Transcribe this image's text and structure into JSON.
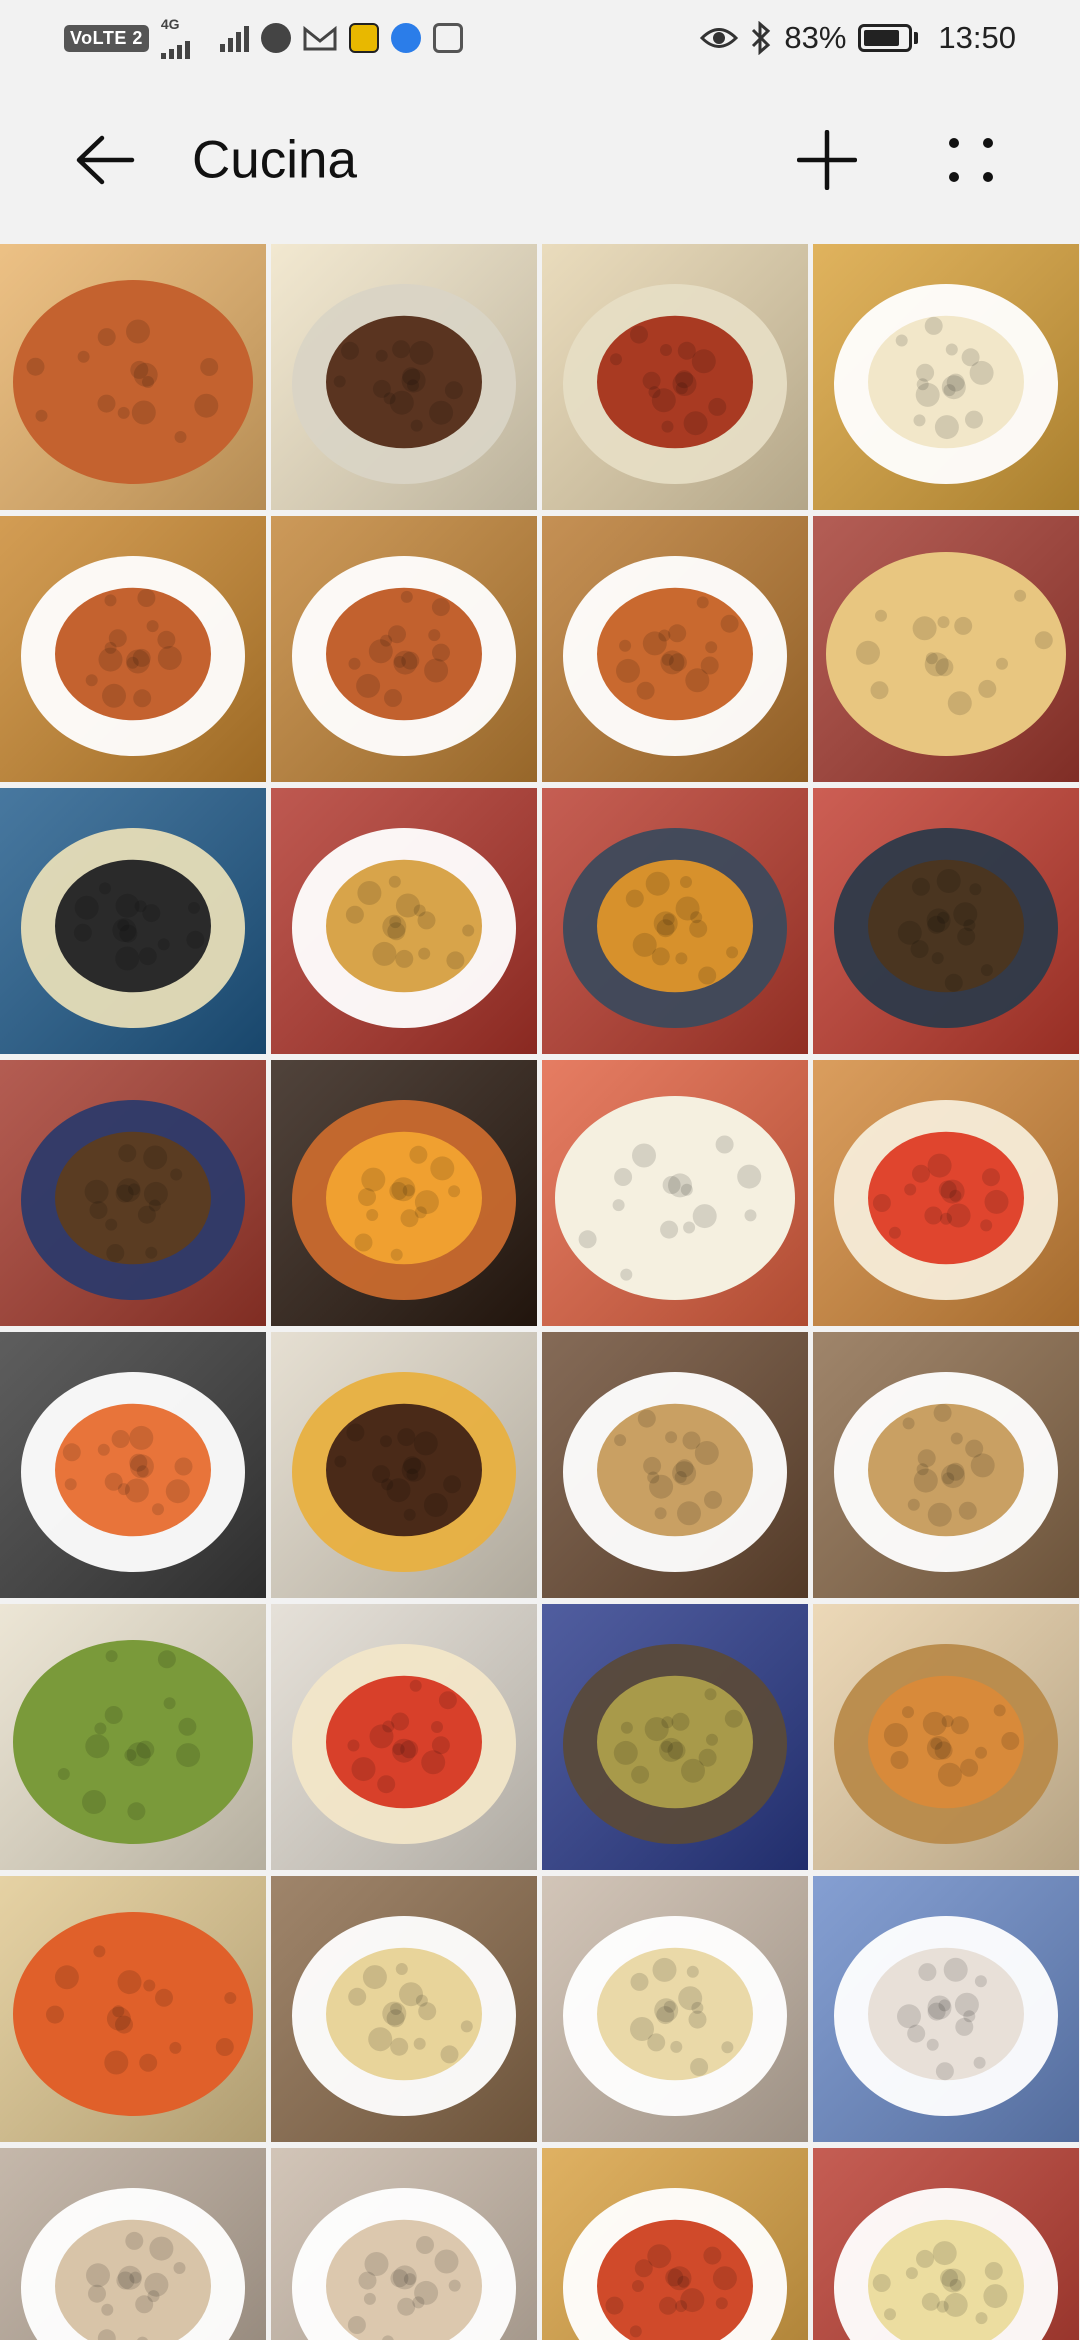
{
  "status_bar": {
    "network_badge": "VoLTE 2",
    "network_type": "4G",
    "battery_percent": "83%",
    "time": "13:50",
    "icons": [
      "volte-icon",
      "signal-icon",
      "signal-icon",
      "facebook-icon",
      "gmail-icon",
      "app-icon",
      "browser-icon",
      "gallery-icon",
      "eye-icon",
      "bluetooth-icon",
      "battery-icon"
    ]
  },
  "app_bar": {
    "title": "Cucina",
    "back_icon": "arrow-left-icon",
    "add_icon": "plus-icon",
    "more_icon": "four-dots-icon"
  },
  "photos": [
    {
      "name": "photo-baked-pasta",
      "bg": "#e8b36a",
      "accent": "#c4622f",
      "plate": "none"
    },
    {
      "name": "photo-polenta-sausage",
      "bg": "#efe3c6",
      "accent": "#5a3420",
      "plate": "#d9d4c5"
    },
    {
      "name": "photo-polenta-ragu",
      "bg": "#e5d4ae",
      "accent": "#a93a22",
      "plate": "#e6ddc4"
    },
    {
      "name": "photo-roast-table",
      "bg": "#d9a23a",
      "accent": "#f2e7c9",
      "plate": "#ffffff"
    },
    {
      "name": "photo-timballo-1",
      "bg": "#c9872e",
      "accent": "#c4622f",
      "plate": "#ffffff"
    },
    {
      "name": "photo-timballo-2",
      "bg": "#c18335",
      "accent": "#c2612e",
      "plate": "#ffffff"
    },
    {
      "name": "photo-timballo-3",
      "bg": "#b8782f",
      "accent": "#c9692f",
      "plate": "#ffffff"
    },
    {
      "name": "photo-focaccia",
      "bg": "#a33a30",
      "accent": "#e8c680",
      "plate": "none"
    },
    {
      "name": "photo-mussels",
      "bg": "#1f5a8a",
      "accent": "#2a2a2a",
      "plate": "#e6ddb7"
    },
    {
      "name": "photo-fried-fish",
      "bg": "#b0342a",
      "accent": "#d8a44a",
      "plate": "#ffffff"
    },
    {
      "name": "photo-roast-vegetables",
      "bg": "#b93b2d",
      "accent": "#d7912c",
      "plate": "#3d4a5c"
    },
    {
      "name": "photo-tray-olives",
      "bg": "#c13b2e",
      "accent": "#4a3520",
      "plate": "#2d3a4a"
    },
    {
      "name": "photo-tray-mushrooms",
      "bg": "#a3392c",
      "accent": "#5a3c22",
      "plate": "#2d3a6a"
    },
    {
      "name": "photo-wood-oven",
      "bg": "#2a1a10",
      "accent": "#f0a030",
      "plate": "#c96a2e"
    },
    {
      "name": "photo-pizza-margherita",
      "bg": "#e06040",
      "accent": "#f5f0e0",
      "plate": "none"
    },
    {
      "name": "photo-pizza-trays",
      "bg": "#d2883a",
      "accent": "#e0452e",
      "plate": "#f5ecd8"
    },
    {
      "name": "photo-rigatoni",
      "bg": "#3a3a3a",
      "accent": "#e8743a",
      "plate": "#ffffff"
    },
    {
      "name": "photo-tiramisu-cake",
      "bg": "#e0d8c8",
      "accent": "#4a2a18",
      "plate": "#e8b040"
    },
    {
      "name": "photo-arancini-plates",
      "bg": "#6a4a32",
      "accent": "#c9a063",
      "plate": "#ffffff"
    },
    {
      "name": "photo-arancini",
      "bg": "#8a6a4a",
      "accent": "#c9a063",
      "plate": "#ffffff"
    },
    {
      "name": "photo-pizza-zucchini-flowers",
      "bg": "#e8e0cc",
      "accent": "#7a9a3a",
      "plate": "none"
    },
    {
      "name": "photo-pizza-basil",
      "bg": "#e0dad0",
      "accent": "#d8402a",
      "plate": "#f2e6c8"
    },
    {
      "name": "photo-pastries-tray",
      "bg": "#2a3a8a",
      "accent": "#a89a4a",
      "plate": "#5a4a3a"
    },
    {
      "name": "photo-calzone",
      "bg": "#e8d0a8",
      "accent": "#d88a3a",
      "plate": "#b88a4a"
    },
    {
      "name": "photo-pizza-oven",
      "bg": "#e0c890",
      "accent": "#e0602a",
      "plate": "none"
    },
    {
      "name": "photo-spaghetti",
      "bg": "#8a6a4a",
      "accent": "#e8d49a",
      "plate": "#ffffff"
    },
    {
      "name": "photo-penne",
      "bg": "#c8b8a8",
      "accent": "#ead9a8",
      "plate": "#ffffff"
    },
    {
      "name": "photo-dessert-cherries",
      "bg": "#6a8ac8",
      "accent": "#e8e0d8",
      "plate": "#ffffff"
    },
    {
      "name": "photo-arancini-table",
      "bg": "#b8a898",
      "accent": "#d8c4a8",
      "plate": "#ffffff"
    },
    {
      "name": "photo-arancini-plate",
      "bg": "#c8b8a8",
      "accent": "#dcc8ae",
      "plate": "#ffffff"
    },
    {
      "name": "photo-black-risotto",
      "bg": "#d8a040",
      "accent": "#d04a2a",
      "plate": "#ffffff"
    },
    {
      "name": "photo-ravioli",
      "bg": "#b83a2e",
      "accent": "#ecdda0",
      "plate": "#ffffff"
    }
  ]
}
